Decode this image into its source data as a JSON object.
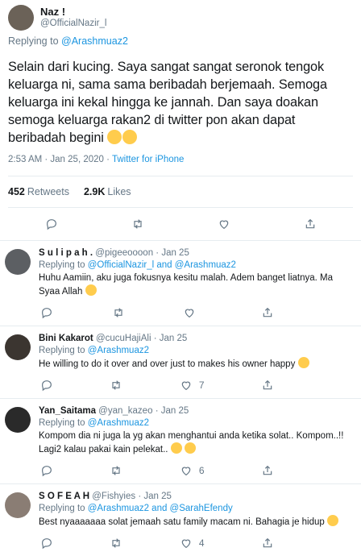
{
  "main": {
    "display_name": "Naz !",
    "handle": "@OfficialNazir_l",
    "replying_prefix": "Replying to",
    "replying_to": "@Arashmuaz2",
    "text": "Selain dari kucing. Saya sangat sangat seronok tengok keluarga ni, sama sama beribadah berjemaah. Semoga keluarga ini kekal hingga ke jannah. Dan saya doakan semoga keluarga rakan2 di twitter pon akan dapat beribadah begini",
    "emoji": "heart-eyes-emoji",
    "timestamp": "2:53 AM · Jan 25, 2020 ·",
    "source": "Twitter for iPhone",
    "retweets_count": "452",
    "retweets_label": "Retweets",
    "likes_count": "2.9K",
    "likes_label": "Likes"
  },
  "replies": [
    {
      "name": "S u l i p a h .",
      "handle": "@pigeeoooon",
      "date": "· Jan 25",
      "replying_prefix": "Replying to",
      "replying_to": "@OfficialNazir_l and @Arashmuaz2",
      "text": "Huhu Aamiin, aku juga fokusnya kesitu malah. Adem banget liatnya. Ma Syaa Allah",
      "like_count": "",
      "color": "#5c5f63"
    },
    {
      "name": "Bini Kakarot",
      "handle": "@cucuHajiAli",
      "date": "· Jan 25",
      "replying_prefix": "Replying to",
      "replying_to": "@Arashmuaz2",
      "text": "He willing to do it over and over just to makes his owner happy",
      "like_count": "7",
      "color": "#3b3530"
    },
    {
      "name": "Yan_Saitama",
      "handle": "@yan_kazeo",
      "date": "· Jan 25",
      "replying_prefix": "Replying to",
      "replying_to": "@Arashmuaz2",
      "text": "Kompom dia ni juga la yg akan menghantui anda ketika solat..  Kompom..!! Lagi2 kalau pakai kain pelekat..",
      "like_count": "6",
      "color": "#2a2a2a"
    },
    {
      "name": "S O F E A H",
      "handle": "@Fishyies",
      "date": "· Jan 25",
      "replying_prefix": "Replying to",
      "replying_to": "@Arashmuaz2 and @SarahEfendy",
      "text": "Best nyaaaaaaa solat jemaah satu family macam ni. Bahagia je hidup",
      "like_count": "4",
      "color": "#8a7d74"
    }
  ]
}
